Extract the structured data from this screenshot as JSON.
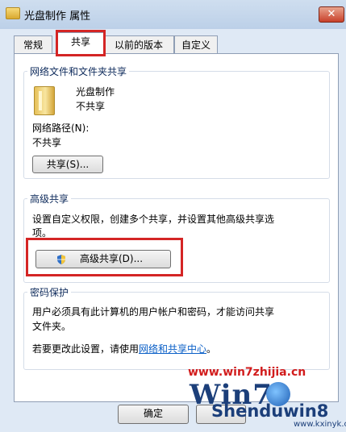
{
  "window": {
    "title": "光盘制作 属性",
    "close_glyph": "✕"
  },
  "tabs": [
    {
      "label": "常规"
    },
    {
      "label": "共享"
    },
    {
      "label": "以前的版本"
    },
    {
      "label": "自定义"
    }
  ],
  "network_sharing": {
    "group_title": "网络文件和文件夹共享",
    "folder_name": "光盘制作",
    "folder_status": "不共享",
    "network_path_label": "网络路径(N):",
    "network_path_value": "不共享",
    "share_button": "共享(S)..."
  },
  "advanced_sharing": {
    "group_title": "高级共享",
    "description_line1": "设置自定义权限，创建多个共享，并设置其他高级共享选",
    "description_line2": "项。",
    "button": "高级共享(D)..."
  },
  "password_protection": {
    "group_title": "密码保护",
    "description_line1": "用户必须具有此计算机的用户帐户和密码，才能访问共享",
    "description_line2": "文件夹。",
    "change_prefix": "若要更改此设置，请使用",
    "change_link": "网络和共享中心",
    "change_suffix": "。"
  },
  "footer": {
    "ok_button": "确定",
    "cancel_button": ""
  },
  "watermark": {
    "site": "www.win7zhijia.cn",
    "logo_text": "Win7",
    "brand": "Shenduwin8",
    "brand_url": "www.kxinyk.com"
  },
  "colors": {
    "highlight": "#d42525",
    "link": "#0a5fc7"
  }
}
